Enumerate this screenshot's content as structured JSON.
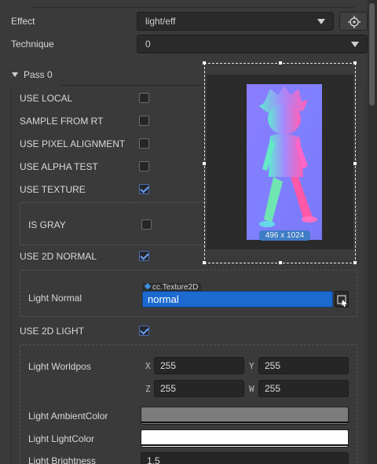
{
  "inspector": {
    "effect_label": "Effect",
    "effect_value": "light/eff",
    "technique_label": "Technique",
    "technique_value": "0",
    "pass_title": "Pass 0"
  },
  "defines": [
    {
      "label": "USE LOCAL",
      "checked": false
    },
    {
      "label": "SAMPLE FROM RT",
      "checked": false
    },
    {
      "label": "USE PIXEL ALIGNMENT",
      "checked": false
    },
    {
      "label": "USE ALPHA TEST",
      "checked": false
    },
    {
      "label": "USE TEXTURE",
      "checked": true
    },
    {
      "label": "IS GRAY",
      "checked": false
    },
    {
      "label": "USE 2D NORMAL",
      "checked": true
    },
    {
      "label": "USE 2D LIGHT",
      "checked": true
    }
  ],
  "light_normal": {
    "label": "Light Normal",
    "asset_type": "cc.Texture2D",
    "value": "normal"
  },
  "light_worldpos": {
    "label": "Light Worldpos",
    "x_axis": "X",
    "x": "255",
    "y_axis": "Y",
    "y": "255",
    "z_axis": "Z",
    "z": "255",
    "w_axis": "W",
    "w": "255"
  },
  "light_ambient": {
    "label": "Light AmbientColor",
    "color": "#7c7c7c"
  },
  "light_color": {
    "label": "Light LightColor",
    "color": "#ffffff"
  },
  "light_brightness": {
    "label": "Light Brightness",
    "value": "1.5"
  },
  "preview": {
    "size_text": "496 x 1024",
    "image_name": "normal-map-character"
  },
  "colors": {
    "background": "#3a3a3a",
    "accent": "#1c6ad0",
    "checkbox_check": "#6aa2ff"
  }
}
